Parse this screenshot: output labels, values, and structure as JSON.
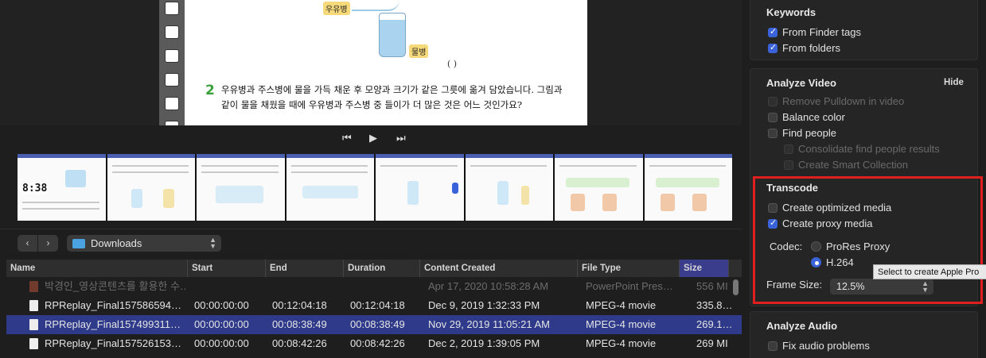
{
  "viewer": {
    "milk_label": "우유병",
    "water_label": "물병",
    "paren": "(                        )",
    "question_number": "2",
    "question_text": "우유병과 주스병에 물을 가득 채운 후 모양과 크기가 같은 그릇에 옮겨 담았습니다. 그림과 같이 물을 채웠을 때에 우유병과 주스병 중 들이가 더 많은 것은 어느 것인가요?",
    "timecode_overlay": "8:38"
  },
  "transport": {
    "prev_icon": "skip-back-icon",
    "play_icon": "play-icon",
    "next_icon": "skip-forward-icon"
  },
  "browser": {
    "back_label": "‹",
    "forward_label": "›",
    "location": "Downloads"
  },
  "table": {
    "columns": [
      {
        "label": "Name"
      },
      {
        "label": "Start"
      },
      {
        "label": "End"
      },
      {
        "label": "Duration"
      },
      {
        "label": "Content Created"
      },
      {
        "label": "File Type"
      },
      {
        "label": "Size"
      }
    ],
    "rows": [
      {
        "name": "박경인_영상콘텐츠를 활용한 수…",
        "start": "",
        "end": "",
        "duration": "",
        "created": "Apr 17, 2020 10:58:28 AM",
        "type": "PowerPoint Pres…",
        "size": "556 MI",
        "state": "dim"
      },
      {
        "name": "RPReplay_Final157586594…",
        "start": "00:00:00:00",
        "end": "00:12:04:18",
        "duration": "00:12:04:18",
        "created": "Dec 9, 2019 1:32:33 PM",
        "type": "MPEG-4 movie",
        "size": "335.8…",
        "state": "normal"
      },
      {
        "name": "RPReplay_Final157499311…",
        "start": "00:00:00:00",
        "end": "00:08:38:49",
        "duration": "00:08:38:49",
        "created": "Nov 29, 2019 11:05:21 AM",
        "type": "MPEG-4 movie",
        "size": "269.1…",
        "state": "selected"
      },
      {
        "name": "RPReplay_Final157526153…",
        "start": "00:00:00:00",
        "end": "00:08:42:26",
        "duration": "00:08:42:26",
        "created": "Dec 2, 2019 1:39:05 PM",
        "type": "MPEG-4 movie",
        "size": "269 MI",
        "state": "normal"
      }
    ]
  },
  "inspector": {
    "keywords": {
      "title": "Keywords",
      "from_finder_tags": "From Finder tags",
      "from_folders": "From folders"
    },
    "analyze_video": {
      "title": "Analyze Video",
      "hide": "Hide",
      "remove_pulldown": "Remove Pulldown in video",
      "balance_color": "Balance color",
      "find_people": "Find people",
      "consolidate": "Consolidate find people results",
      "smart_collection": "Create Smart Collection"
    },
    "transcode": {
      "title": "Transcode",
      "optimized": "Create optimized media",
      "proxy": "Create proxy media",
      "codec_label": "Codec:",
      "codec_prores": "ProRes Proxy",
      "codec_h264": "H.264",
      "frame_size_label": "Frame Size:",
      "frame_size_value": "12.5%",
      "tooltip": "Select to create Apple Pro"
    },
    "analyze_audio": {
      "title": "Analyze Audio",
      "fix_audio": "Fix audio problems"
    },
    "highlight_color": "#e0201f",
    "accent_color": "#3b63d9"
  }
}
